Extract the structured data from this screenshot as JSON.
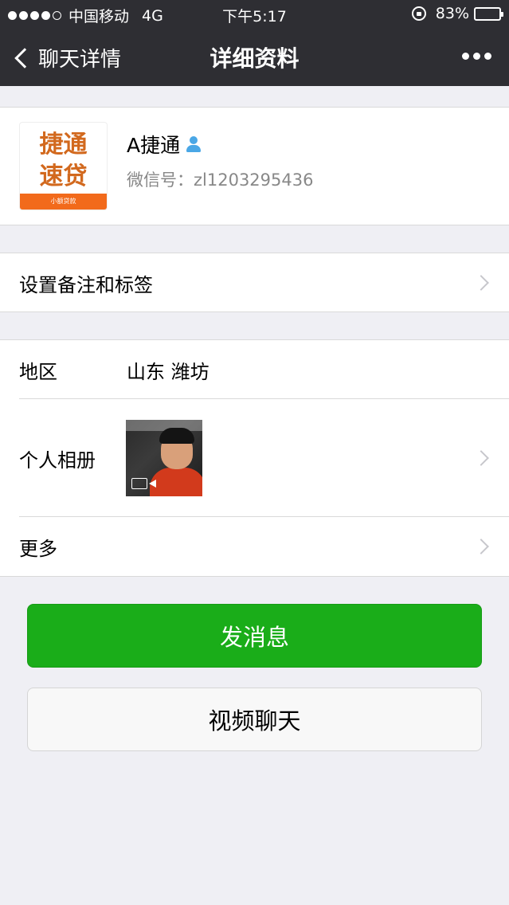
{
  "status_bar": {
    "carrier": "中国移动",
    "network": "4G",
    "time": "下午5:17",
    "battery": "83%",
    "battery_level": 0.83
  },
  "nav": {
    "back_label": "聊天详情",
    "title": "详细资料"
  },
  "profile": {
    "name": "A捷通",
    "wechat_id": "微信号：zl1203295436",
    "avatar_text": "捷通\n速贷",
    "avatar_subtext": "小额贷款"
  },
  "remark_row": {
    "label": "设置备注和标签"
  },
  "info": {
    "region_label": "地区",
    "region_value": "山东 潍坊",
    "album_label": "个人相册",
    "more_label": "更多"
  },
  "buttons": {
    "send_message": "发消息",
    "video_chat": "视频聊天"
  },
  "colors": {
    "nav_bg": "#2e2e33",
    "primary_green": "#1aad19",
    "page_bg": "#efeff4",
    "verified_blue": "#4aa7e6"
  }
}
